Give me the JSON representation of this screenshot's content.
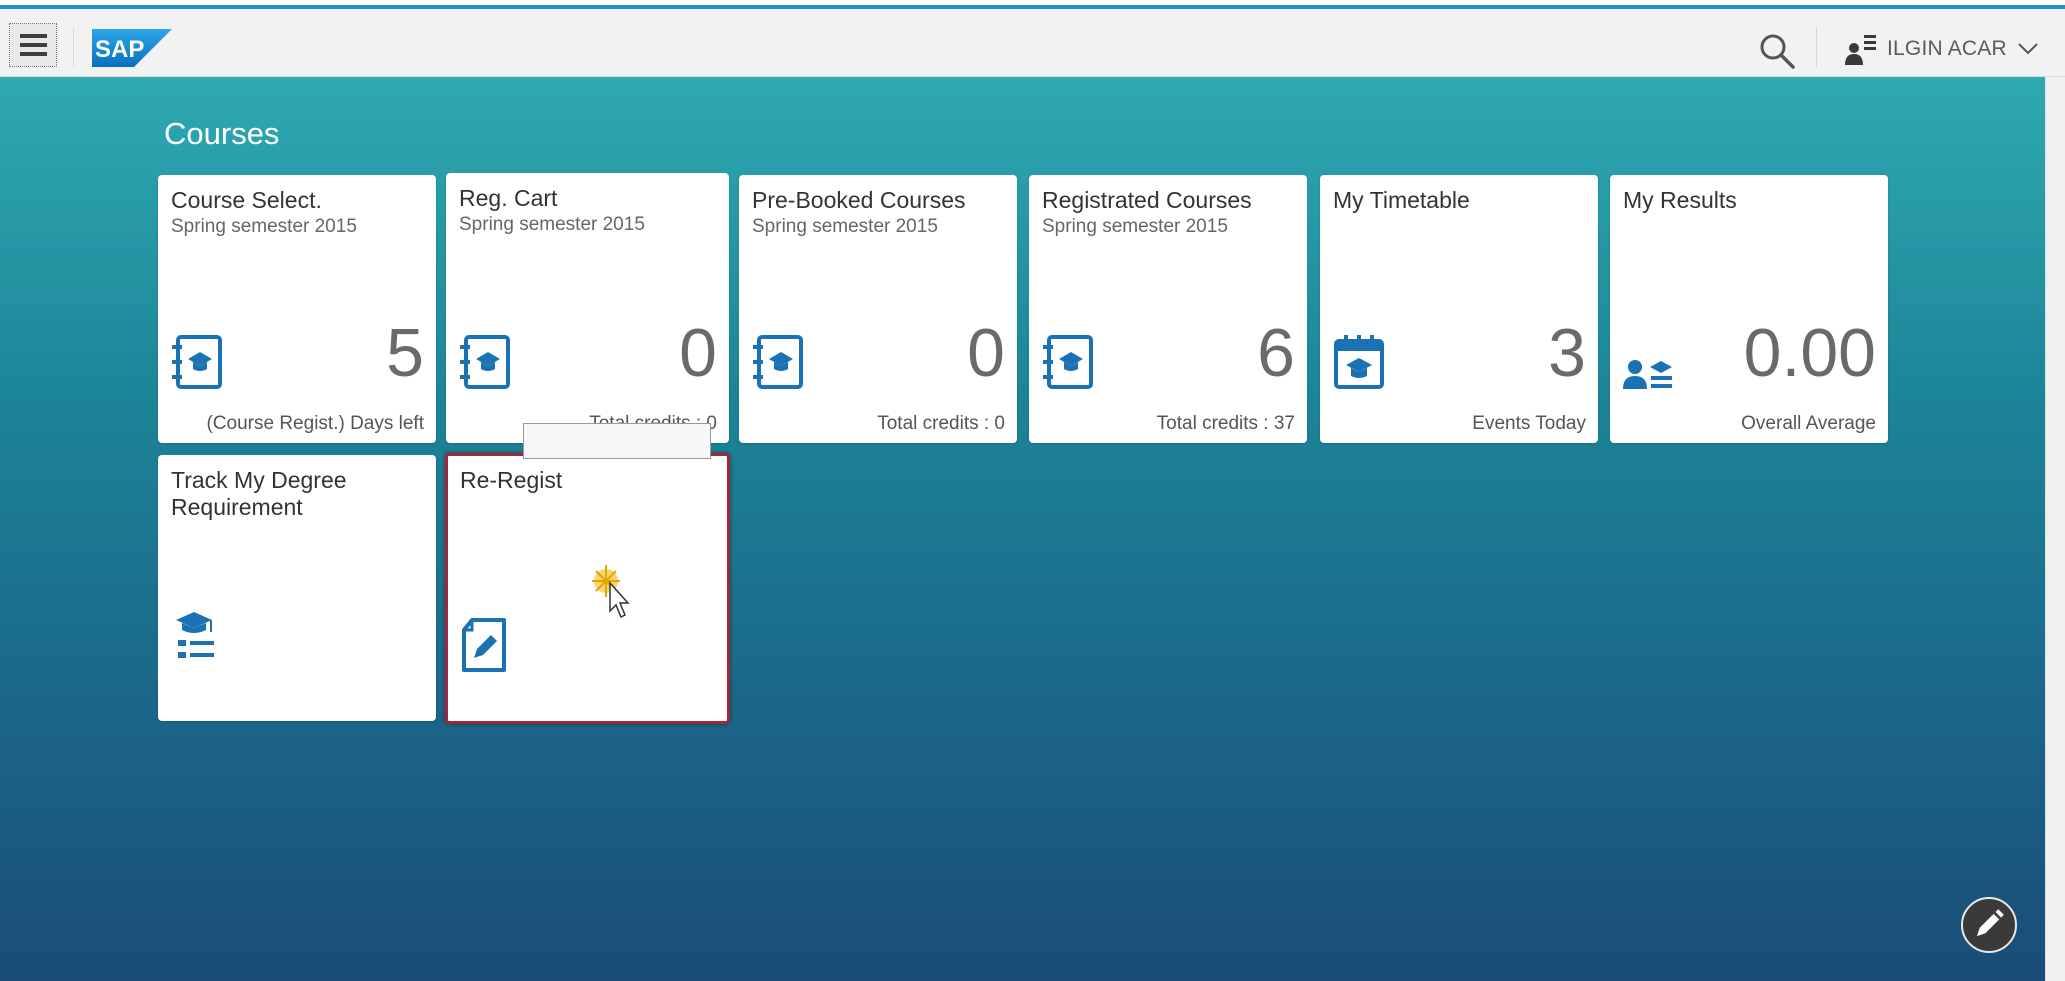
{
  "shell": {
    "logo": "SAP",
    "user_name": "ILGIN ACAR"
  },
  "group": {
    "title": "Courses"
  },
  "tiles": [
    {
      "title": "Course Select.",
      "subtitle": "Spring semester 2015",
      "number": "5",
      "footer": "(Course Regist.) Days left",
      "icon": "course-book-icon"
    },
    {
      "title": "Reg. Cart",
      "subtitle": "Spring semester 2015",
      "number": "0",
      "footer": "Total credits : 0",
      "icon": "course-book-icon"
    },
    {
      "title": "Pre-Booked Courses",
      "subtitle": "Spring semester 2015",
      "number": "0",
      "footer": "Total credits : 0",
      "icon": "course-book-icon"
    },
    {
      "title": "Registrated Courses",
      "subtitle": "Spring semester 2015",
      "number": "6",
      "footer": "Total credits : 37",
      "icon": "course-book-icon"
    },
    {
      "title": "My Timetable",
      "subtitle": "",
      "number": "3",
      "footer": "Events Today",
      "icon": "calendar-education-icon"
    },
    {
      "title": "My Results",
      "subtitle": "",
      "number": "0.00",
      "footer": "Overall Average",
      "icon": "student-results-icon"
    },
    {
      "title": "Track My Degree Requirement",
      "subtitle": "",
      "number": "",
      "footer": "",
      "icon": "degree-list-icon"
    },
    {
      "title": "Re-Regist",
      "subtitle": "",
      "number": "",
      "footer": "",
      "icon": "edit-document-icon"
    }
  ],
  "colors": {
    "shell_accent": "#1d8fd6",
    "icon_blue": "#1a72b5",
    "selected_border": "#a0283a"
  }
}
